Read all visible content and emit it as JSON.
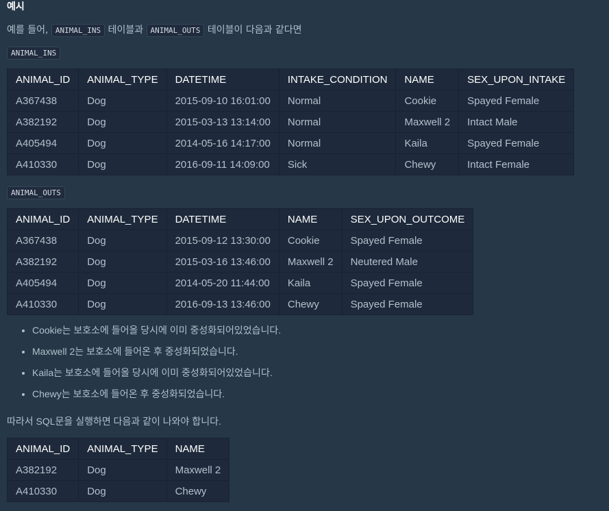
{
  "section_title": "예시",
  "intro": {
    "before": "예를 들어,",
    "code1": "ANIMAL_INS",
    "middle": "테이블과",
    "code2": "ANIMAL_OUTS",
    "after": "테이블이 다음과 같다면"
  },
  "ins_table": {
    "label": "ANIMAL_INS",
    "headers": [
      "ANIMAL_ID",
      "ANIMAL_TYPE",
      "DATETIME",
      "INTAKE_CONDITION",
      "NAME",
      "SEX_UPON_INTAKE"
    ],
    "rows": [
      [
        "A367438",
        "Dog",
        "2015-09-10 16:01:00",
        "Normal",
        "Cookie",
        "Spayed Female"
      ],
      [
        "A382192",
        "Dog",
        "2015-03-13 13:14:00",
        "Normal",
        "Maxwell 2",
        "Intact Male"
      ],
      [
        "A405494",
        "Dog",
        "2014-05-16 14:17:00",
        "Normal",
        "Kaila",
        "Spayed Female"
      ],
      [
        "A410330",
        "Dog",
        "2016-09-11 14:09:00",
        "Sick",
        "Chewy",
        "Intact Female"
      ]
    ]
  },
  "outs_table": {
    "label": "ANIMAL_OUTS",
    "headers": [
      "ANIMAL_ID",
      "ANIMAL_TYPE",
      "DATETIME",
      "NAME",
      "SEX_UPON_OUTCOME"
    ],
    "rows": [
      [
        "A367438",
        "Dog",
        "2015-09-12 13:30:00",
        "Cookie",
        "Spayed Female"
      ],
      [
        "A382192",
        "Dog",
        "2015-03-16 13:46:00",
        "Maxwell 2",
        "Neutered Male"
      ],
      [
        "A405494",
        "Dog",
        "2014-05-20 11:44:00",
        "Kaila",
        "Spayed Female"
      ],
      [
        "A410330",
        "Dog",
        "2016-09-13 13:46:00",
        "Chewy",
        "Spayed Female"
      ]
    ]
  },
  "notes": [
    "Cookie는 보호소에 들어올 당시에 이미 중성화되어있었습니다.",
    "Maxwell 2는 보호소에 들어온 후 중성화되었습니다.",
    "Kaila는 보호소에 들어올 당시에 이미 중성화되어있었습니다.",
    "Chewy는 보호소에 들어온 후 중성화되었습니다."
  ],
  "result_intro": "따라서 SQL문을 실행하면 다음과 같이 나와야 합니다.",
  "result_table": {
    "headers": [
      "ANIMAL_ID",
      "ANIMAL_TYPE",
      "NAME"
    ],
    "rows": [
      [
        "A382192",
        "Dog",
        "Maxwell 2"
      ],
      [
        "A410330",
        "Dog",
        "Chewy"
      ]
    ]
  }
}
